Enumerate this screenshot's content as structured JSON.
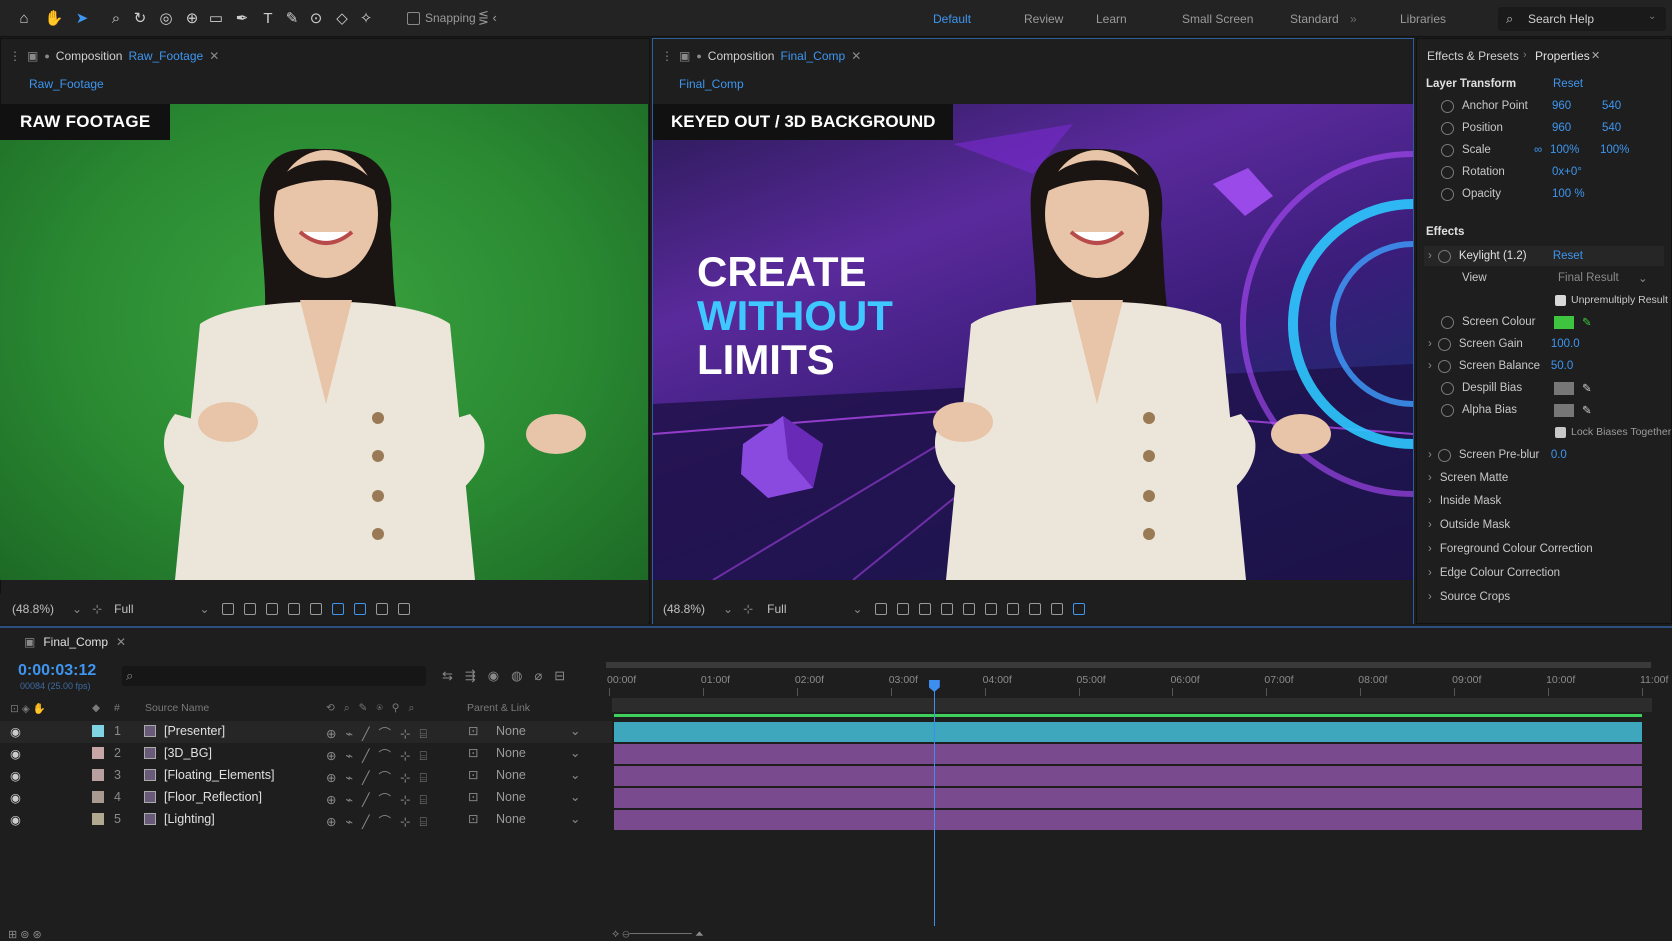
{
  "toolbar": {
    "snapping_label": "Snapping",
    "workspaces": [
      "Default",
      "Review",
      "Learn",
      "Small Screen",
      "Standard",
      "Libraries"
    ],
    "search_label": "Search Help"
  },
  "comp_left": {
    "tab_prefix": "Composition",
    "tab_name": "Raw_Footage",
    "subtab": "Raw_Footage",
    "overlay_label": "RAW FOOTAGE",
    "zoom": "(48.8%)",
    "resolution": "Full"
  },
  "comp_right": {
    "tab_prefix": "Composition",
    "tab_name": "Final_Comp",
    "subtab": "Final_Comp",
    "overlay_label": "KEYED OUT / 3D BACKGROUND",
    "headline": [
      "CREATE",
      "WITHOUT",
      "LIMITS"
    ],
    "zoom": "(48.8%)",
    "resolution": "Full"
  },
  "right_panel": {
    "tab_effects": "Effects & Presets",
    "tab_properties": "Properties",
    "layer_transform": {
      "title": "Layer Transform",
      "reset": "Reset",
      "rows": [
        {
          "label": "Anchor Point",
          "v1": "960",
          "v2": "540"
        },
        {
          "label": "Position",
          "v1": "960",
          "v2": "540"
        },
        {
          "label": "Scale",
          "v1": "100%",
          "v2": "100%"
        },
        {
          "label": "Rotation",
          "v1": "0x+0°",
          "v2": ""
        },
        {
          "label": "Opacity",
          "v1": "100 %",
          "v2": ""
        }
      ]
    },
    "effects": {
      "title": "Effects",
      "effect_name": "Keylight (1.2)",
      "reset": "Reset",
      "view_label": "View",
      "view_value": "Final Result",
      "unpremultiply": "Unpremultiply Result",
      "screen_colour": "Screen Colour",
      "screen_colour_hex": "#3ec43e",
      "screen_gain_label": "Screen Gain",
      "screen_gain": "100.0",
      "screen_balance_label": "Screen Balance",
      "screen_balance": "50.0",
      "despill_bias": "Despill Bias",
      "alpha_bias": "Alpha Bias",
      "lock_biases": "Lock Biases Together",
      "preblur_label": "Screen Pre-blur",
      "preblur": "0.0",
      "groups": [
        "Screen Matte",
        "Inside Mask",
        "Outside Mask",
        "Foreground Colour Correction",
        "Edge Colour Correction",
        "Source Crops"
      ]
    }
  },
  "timeline": {
    "tab_name": "Final_Comp",
    "timecode": "0:00:03:12",
    "frame_info": "00084 (25.00 fps)",
    "col_source": "Source Name",
    "col_parent": "Parent & Link",
    "ruler": [
      "00:00f",
      "01:00f",
      "02:00f",
      "03:00f",
      "04:00f",
      "05:00f",
      "06:00f",
      "07:00f",
      "08:00f",
      "09:00f",
      "10:00f",
      "11:00f"
    ],
    "playhead_seconds": 3.48,
    "layers": [
      {
        "num": "1",
        "name": "[Presenter]",
        "label_color": "#7fd3e3",
        "parent": "None",
        "bar_color": "#3fa7bd"
      },
      {
        "num": "2",
        "name": "[3D_BG]",
        "label_color": "#c8a6a6",
        "parent": "None",
        "bar_color": "#7a4a8e"
      },
      {
        "num": "3",
        "name": "[Floating_Elements]",
        "label_color": "#b8a0a0",
        "parent": "None",
        "bar_color": "#7a4a8e"
      },
      {
        "num": "4",
        "name": "[Floor_Reflection]",
        "label_color": "#a89a90",
        "parent": "None",
        "bar_color": "#7a4a8e"
      },
      {
        "num": "5",
        "name": "[Lighting]",
        "label_color": "#b0a890",
        "parent": "None",
        "bar_color": "#7a4a8e"
      }
    ]
  }
}
